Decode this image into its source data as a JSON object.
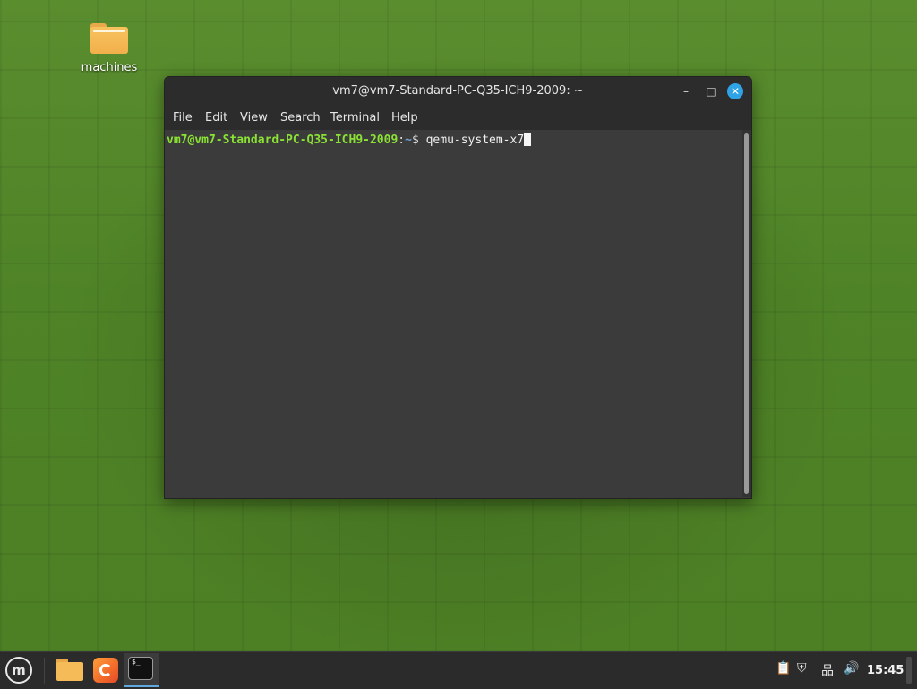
{
  "desktop": {
    "icons": [
      {
        "label": "machines",
        "icon": "folder-icon"
      }
    ]
  },
  "window": {
    "title": "vm7@vm7-Standard-PC-Q35-ICH9-2009: ~",
    "menu": [
      "File",
      "Edit",
      "View",
      "Search",
      "Terminal",
      "Help"
    ],
    "controls": {
      "minimize": "–",
      "maximize": "□",
      "close": "✕"
    }
  },
  "terminal": {
    "prompt_user_host": "vm7@vm7-Standard-PC-Q35-ICH9-2009",
    "prompt_sep": ":",
    "prompt_dir": "~",
    "prompt_symbol": "$ ",
    "command": "qemu-system-x7"
  },
  "taskbar": {
    "launchers": [
      "mint-menu-icon",
      "files-icon",
      "firefox-icon",
      "terminal-icon"
    ],
    "terminal_glyph": "$_",
    "tray": {
      "clipboard": "📋",
      "shield": "⛨",
      "network": "品",
      "volume": "🔊"
    },
    "clock": "15:45"
  },
  "colors": {
    "desktop_green": "#4f8327",
    "prompt_user": "#8ae234",
    "prompt_dir": "#729fcf",
    "close_button": "#2fa3e6"
  }
}
